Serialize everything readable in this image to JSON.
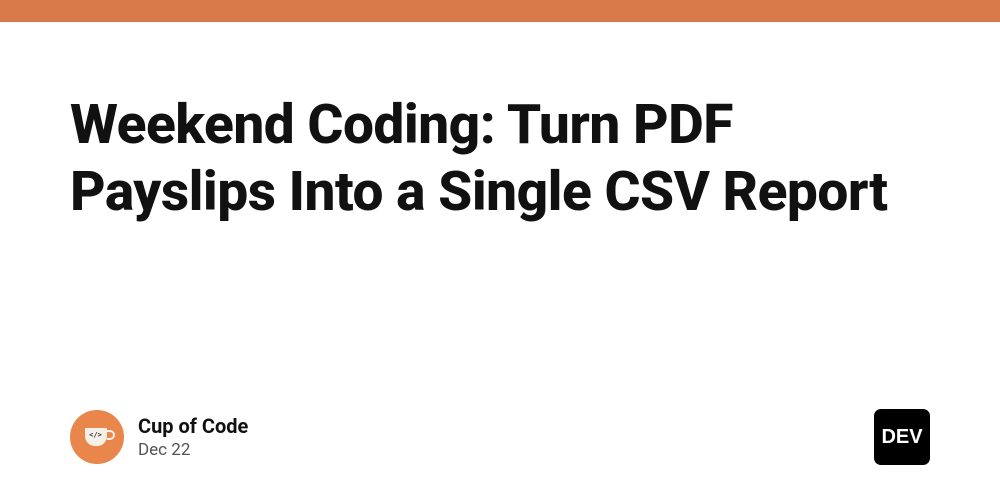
{
  "accent_color": "#d97a4a",
  "article": {
    "title": "Weekend Coding: Turn PDF Payslips Into a Single CSV Report"
  },
  "author": {
    "name": "Cup of Code",
    "date": "Dec 22",
    "avatar_icon": "coffee-cup-code"
  },
  "platform": {
    "badge_label": "DEV"
  }
}
